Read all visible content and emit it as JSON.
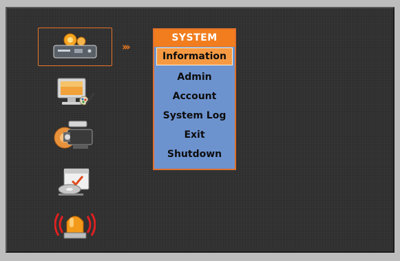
{
  "menu": {
    "title": "SYSTEM",
    "items": [
      {
        "label": "Information",
        "active": true
      },
      {
        "label": "Admin",
        "active": false
      },
      {
        "label": "Account",
        "active": false
      },
      {
        "label": "System Log",
        "active": false
      },
      {
        "label": "Exit",
        "active": false
      },
      {
        "label": "Shutdown",
        "active": false
      }
    ]
  },
  "categories": [
    {
      "icon": "system-dvr-icon",
      "selected": true
    },
    {
      "icon": "display-paint-icon",
      "selected": false
    },
    {
      "icon": "camera-icon",
      "selected": false
    },
    {
      "icon": "schedule-disk-icon",
      "selected": false
    },
    {
      "icon": "alarm-siren-icon",
      "selected": false
    }
  ],
  "pointer_arrows": "›››",
  "colors": {
    "accent_orange": "#f27d1e",
    "menu_blue": "#6d93cf",
    "active_item": "#f59a43",
    "background": "#2f2f2f"
  }
}
